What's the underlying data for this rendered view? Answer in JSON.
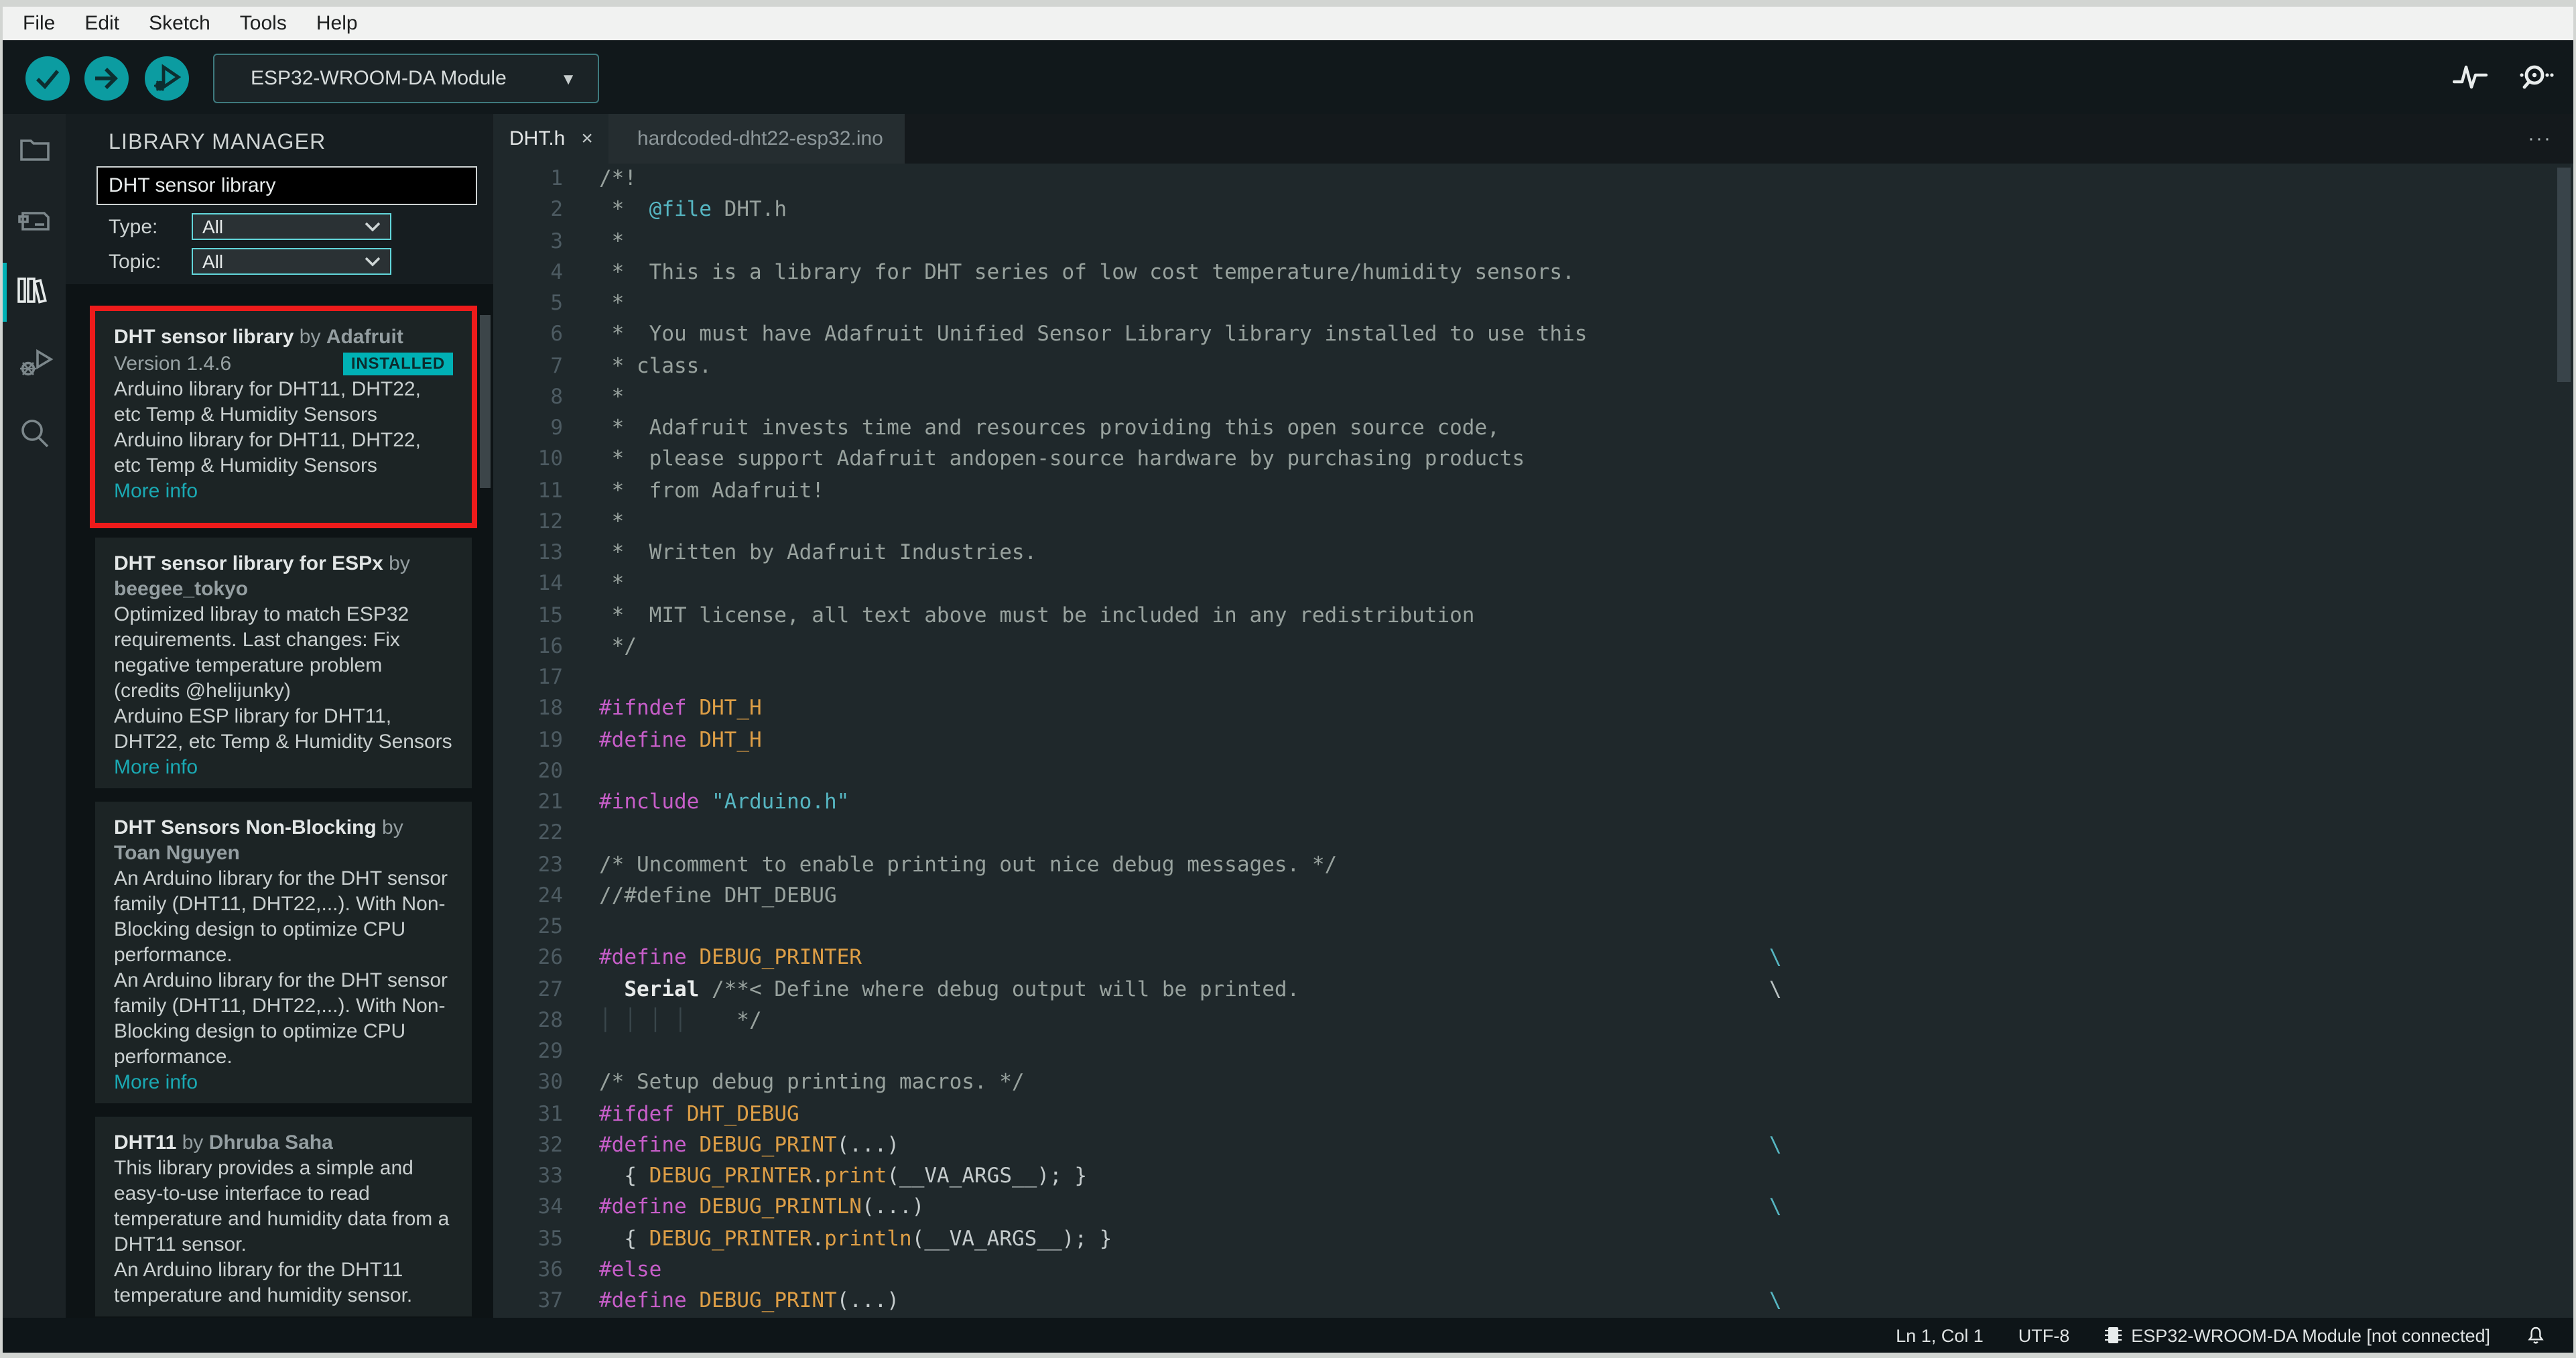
{
  "colors": {
    "accent_teal": "#00b1b5",
    "annotation_red": "#ee1b1b",
    "installed_badge_bg": "#00b1b5",
    "more_info_link": "#1aa9b3",
    "syntax": {
      "comment": "#98a29e",
      "keyword": "#c75ec9",
      "macro": "#dd9e46",
      "string": "#56b6c2",
      "doc_tag": "#56b6c2",
      "plain": "#c4cbcc"
    }
  },
  "menu": {
    "items": [
      "File",
      "Edit",
      "Sketch",
      "Tools",
      "Help"
    ]
  },
  "toolbar": {
    "verify_button": "verify",
    "upload_button": "upload",
    "debug_button": "start-debugging",
    "board_selector": "ESP32-WROOM-DA Module",
    "right_icons": [
      "serial-plotter",
      "serial-monitor"
    ]
  },
  "activity_bar": {
    "items": [
      {
        "name": "sketchbook",
        "active": false
      },
      {
        "name": "boards-manager",
        "active": false
      },
      {
        "name": "library-manager",
        "active": true
      },
      {
        "name": "debug",
        "active": false
      },
      {
        "name": "search",
        "active": false
      }
    ]
  },
  "library_manager": {
    "title": "LIBRARY MANAGER",
    "search_value": "DHT sensor library",
    "filters": [
      {
        "label": "Type:",
        "value": "All"
      },
      {
        "label": "Topic:",
        "value": "All"
      }
    ],
    "entries": [
      {
        "name": "DHT sensor library",
        "by": "by",
        "author": "Adafruit",
        "version": "Version 1.4.6",
        "badge": "INSTALLED",
        "description": [
          "Arduino library for DHT11, DHT22, etc Temp & Humidity Sensors",
          "Arduino library for DHT11, DHT22, etc Temp & Humidity Sensors"
        ],
        "more_info": "More info",
        "highlighted": true
      },
      {
        "name": "DHT sensor library for ESPx",
        "by": "by",
        "author": "beegee_tokyo",
        "description": [
          "Optimized libray to match ESP32 requirements. Last changes: Fix negative temperature problem (credits @helijunky)",
          "Arduino ESP library for DHT11, DHT22, etc Temp & Humidity Sensors"
        ],
        "more_info": "More info"
      },
      {
        "name": "DHT Sensors Non-Blocking",
        "by": "by",
        "author": "Toan Nguyen",
        "description": [
          "An Arduino library for the DHT sensor family (DHT11, DHT22,...). With Non-Blocking design to optimize CPU performance.",
          "An Arduino library for the DHT sensor family (DHT11, DHT22,...). With Non-Blocking design to optimize CPU performance."
        ],
        "more_info": "More info"
      },
      {
        "name": "DHT11",
        "by": "by",
        "author": "Dhruba Saha",
        "description": [
          "This library provides a simple and easy-to-use interface to read temperature and humidity data from a DHT11 sensor.",
          "An Arduino library for the DHT11 temperature and humidity sensor."
        ]
      }
    ]
  },
  "editor": {
    "tabs": [
      {
        "label": "DHT.h",
        "active": true,
        "closable": true
      },
      {
        "label": "hardcoded-dht22-esp32.ino",
        "active": false
      }
    ],
    "more_actions": "···",
    "lines": [
      {
        "n": 1,
        "t": [
          [
            "/*!",
            "c"
          ]
        ]
      },
      {
        "n": 2,
        "t": [
          [
            " *  ",
            "c"
          ],
          [
            "@file",
            "d"
          ],
          [
            " DHT.h",
            "c"
          ]
        ]
      },
      {
        "n": 3,
        "t": [
          [
            " *",
            "c"
          ]
        ]
      },
      {
        "n": 4,
        "t": [
          [
            " *  This is a library for DHT series of low cost temperature/humidity sensors.",
            "c"
          ]
        ]
      },
      {
        "n": 5,
        "t": [
          [
            " *",
            "c"
          ]
        ]
      },
      {
        "n": 6,
        "t": [
          [
            " *  You must have Adafruit Unified Sensor Library library installed to use this",
            "c"
          ]
        ]
      },
      {
        "n": 7,
        "t": [
          [
            " * class.",
            "c"
          ]
        ]
      },
      {
        "n": 8,
        "t": [
          [
            " *",
            "c"
          ]
        ]
      },
      {
        "n": 9,
        "t": [
          [
            " *  Adafruit invests time and resources providing this open source code,",
            "c"
          ]
        ]
      },
      {
        "n": 10,
        "t": [
          [
            " *  please support Adafruit andopen-source hardware by purchasing products",
            "c"
          ]
        ]
      },
      {
        "n": 11,
        "t": [
          [
            " *  from Adafruit!",
            "c"
          ]
        ]
      },
      {
        "n": 12,
        "t": [
          [
            " *",
            "c"
          ]
        ]
      },
      {
        "n": 13,
        "t": [
          [
            " *  Written by Adafruit Industries.",
            "c"
          ]
        ]
      },
      {
        "n": 14,
        "t": [
          [
            " *",
            "c"
          ]
        ]
      },
      {
        "n": 15,
        "t": [
          [
            " *  MIT license, all text above must be included in any redistribution",
            "c"
          ]
        ]
      },
      {
        "n": 16,
        "t": [
          [
            " */",
            "c"
          ]
        ]
      },
      {
        "n": 17,
        "t": []
      },
      {
        "n": 18,
        "t": [
          [
            "#ifndef",
            "k"
          ],
          [
            " ",
            "p"
          ],
          [
            "DHT_H",
            "m"
          ]
        ]
      },
      {
        "n": 19,
        "t": [
          [
            "#define",
            "k"
          ],
          [
            " ",
            "p"
          ],
          [
            "DHT_H",
            "m"
          ]
        ]
      },
      {
        "n": 20,
        "t": []
      },
      {
        "n": 21,
        "t": [
          [
            "#include",
            "k"
          ],
          [
            " ",
            "p"
          ],
          [
            "\"Arduino.h\"",
            "s"
          ]
        ]
      },
      {
        "n": 22,
        "t": []
      },
      {
        "n": 23,
        "t": [
          [
            "/* Uncomment to enable printing out nice debug messages. */",
            "c"
          ]
        ]
      },
      {
        "n": 24,
        "t": [
          [
            "//#define DHT_DEBUG",
            "c"
          ]
        ]
      },
      {
        "n": 25,
        "t": []
      },
      {
        "n": 26,
        "t": [
          [
            "#define",
            "k"
          ],
          [
            " ",
            "p"
          ],
          [
            "DEBUG_PRINTER",
            "m"
          ]
        ],
        "b": "cyan"
      },
      {
        "n": 27,
        "t": [
          [
            "  ",
            "p"
          ],
          [
            "Serial",
            "w"
          ],
          [
            " /**< Define where debug output will be printed.",
            "c"
          ]
        ],
        "b": "gray"
      },
      {
        "n": 28,
        "t": [
          [
            "│ │ │ │",
            "g"
          ],
          [
            "    */",
            "c"
          ]
        ]
      },
      {
        "n": 29,
        "t": []
      },
      {
        "n": 30,
        "t": [
          [
            "/* Setup debug printing macros. */",
            "c"
          ]
        ]
      },
      {
        "n": 31,
        "t": [
          [
            "#ifdef",
            "k"
          ],
          [
            " ",
            "p"
          ],
          [
            "DHT_DEBUG",
            "m"
          ]
        ]
      },
      {
        "n": 32,
        "t": [
          [
            "#define",
            "k"
          ],
          [
            " ",
            "p"
          ],
          [
            "DEBUG_PRINT",
            "m"
          ],
          [
            "(...)",
            "p"
          ]
        ],
        "b": "cyan"
      },
      {
        "n": 33,
        "t": [
          [
            "  { ",
            "p"
          ],
          [
            "DEBUG_PRINTER",
            "m"
          ],
          [
            ".",
            "p"
          ],
          [
            "print",
            "m"
          ],
          [
            "(",
            "p"
          ],
          [
            "__VA_ARGS__",
            "p"
          ],
          [
            "); }",
            "p"
          ]
        ]
      },
      {
        "n": 34,
        "t": [
          [
            "#define",
            "k"
          ],
          [
            " ",
            "p"
          ],
          [
            "DEBUG_PRINTLN",
            "m"
          ],
          [
            "(...)",
            "p"
          ]
        ],
        "b": "cyan"
      },
      {
        "n": 35,
        "t": [
          [
            "  { ",
            "p"
          ],
          [
            "DEBUG_PRINTER",
            "m"
          ],
          [
            ".",
            "p"
          ],
          [
            "println",
            "m"
          ],
          [
            "(",
            "p"
          ],
          [
            "__VA_ARGS__",
            "p"
          ],
          [
            "); }",
            "p"
          ]
        ]
      },
      {
        "n": 36,
        "t": [
          [
            "#else",
            "k"
          ]
        ]
      },
      {
        "n": 37,
        "t": [
          [
            "#define",
            "k"
          ],
          [
            " ",
            "p"
          ],
          [
            "DEBUG_PRINT",
            "m"
          ],
          [
            "(...)",
            "p"
          ]
        ],
        "b": "cyan"
      }
    ]
  },
  "statusbar": {
    "cursor": "Ln 1, Col 1",
    "encoding": "UTF-8",
    "board_status": "ESP32-WROOM-DA Module [not connected]"
  }
}
